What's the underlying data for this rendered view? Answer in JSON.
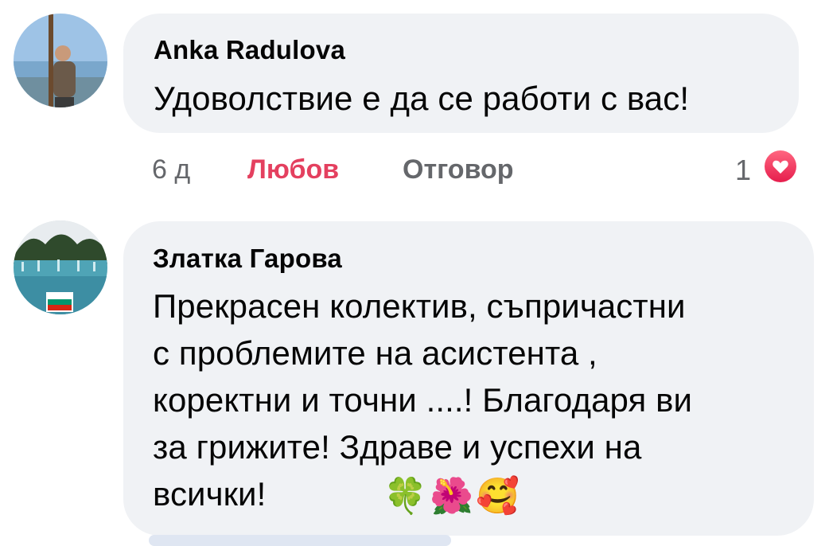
{
  "comments": [
    {
      "author": "Anka Radulova",
      "text": "Удоволствие е да се работи с вас!",
      "time": "6 д",
      "reaction_label": "Любов",
      "reply_label": "Отговор",
      "reaction_count": "1",
      "reaction_icon": "heart-icon"
    },
    {
      "author": "Златка Гарова",
      "text_lines": [
        "Прекрасен колектив, съпричастни",
        "с проблемите на асистента ,",
        "коректни и точни ....! Благодаря ви",
        "за грижите! Здраве и успехи на",
        "всички!"
      ],
      "emojis": [
        "🍀",
        "🌺",
        "🥰"
      ],
      "avatar_flag": "bulgaria-flag"
    }
  ],
  "colors": {
    "bubble": "#f0f2f5",
    "love": "#e4405f",
    "secondary_text": "#65676b",
    "primary_text": "#050505"
  }
}
